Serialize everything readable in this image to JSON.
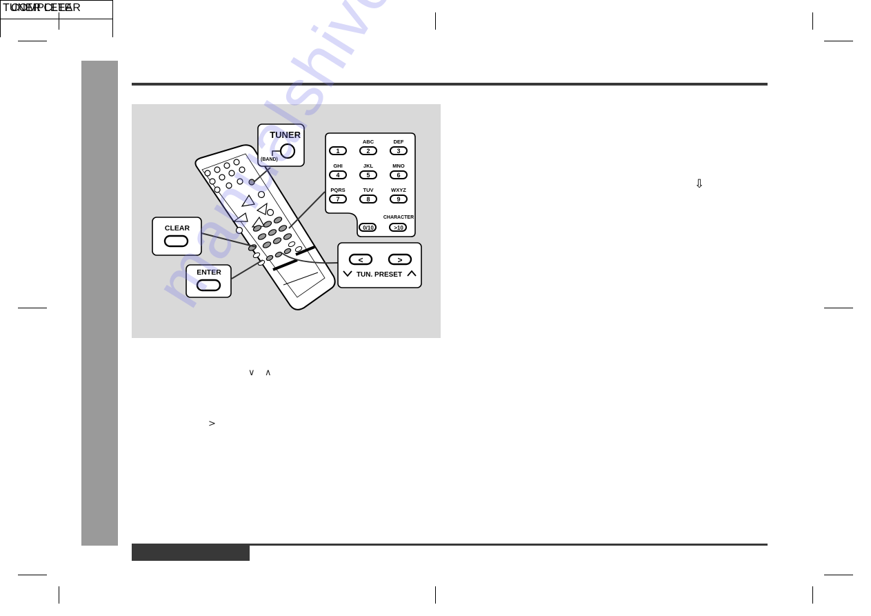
{
  "figure": {
    "callouts": {
      "tuner": {
        "label": "TUNER",
        "sublabel": "(BAND)"
      },
      "clear": {
        "label": "CLEAR"
      },
      "enter": {
        "label": "ENTER"
      },
      "tun_preset": {
        "label": "TUN. PRESET",
        "left_button": "<",
        "right_button": ">"
      },
      "keypad": {
        "keys": [
          {
            "letters": "",
            "digit": "1"
          },
          {
            "letters": "ABC",
            "digit": "2"
          },
          {
            "letters": "DEF",
            "digit": "3"
          },
          {
            "letters": "GHI",
            "digit": "4"
          },
          {
            "letters": "JKL",
            "digit": "5"
          },
          {
            "letters": "MNO",
            "digit": "6"
          },
          {
            "letters": "PQRS",
            "digit": "7"
          },
          {
            "letters": "TUV",
            "digit": "8"
          },
          {
            "letters": "WXYZ",
            "digit": "9"
          }
        ],
        "zero_key": "0/10",
        "character_label": "CHARACTER",
        "over_ten_key": ">10"
      }
    }
  },
  "body_glyphs": {
    "down_caret": "∨",
    "up_caret": "∧",
    "right_caret": ">"
  },
  "display": {
    "line1": "TUNER CLEAR",
    "arrow": "⇩",
    "line2": "COMPLETE"
  },
  "watermark": "manualshive.com"
}
